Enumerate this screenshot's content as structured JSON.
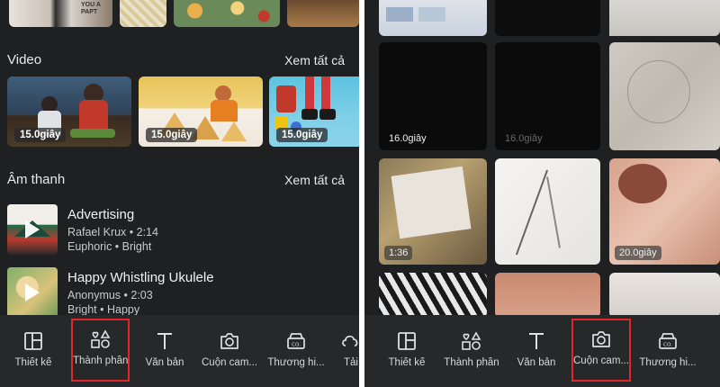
{
  "left": {
    "video_section": {
      "title": "Video",
      "see_all": "Xem tất cả"
    },
    "videos": [
      {
        "duration": "15.0giây"
      },
      {
        "duration": "15.0giây"
      },
      {
        "duration": "15.0giây"
      }
    ],
    "top_thumb_text": "YOU A PAPT",
    "audio_section": {
      "title": "Âm thanh",
      "see_all": "Xem tất cả"
    },
    "tracks": [
      {
        "title": "Advertising",
        "artist_duration": "Rafael Krux • 2:14",
        "tags": "Euphoric • Bright"
      },
      {
        "title": "Happy Whistling Ukulele",
        "artist_duration": "Anonymus • 2:03",
        "tags": "Bright • Happy"
      }
    ],
    "nav": [
      {
        "label": "Thiết kế",
        "icon": "layout-icon"
      },
      {
        "label": "Thành phần",
        "icon": "elements-icon",
        "selected": true
      },
      {
        "label": "Văn bản",
        "icon": "text-icon"
      },
      {
        "label": "Cuộn cam...",
        "icon": "camera-icon"
      },
      {
        "label": "Thương hi...",
        "icon": "brand-icon"
      },
      {
        "label": "Tải",
        "icon": "upload-icon"
      }
    ]
  },
  "right": {
    "grid_badges": {
      "video1": "16.0giây",
      "video2": "16.0giây",
      "video3": "1:36",
      "video4": "20.0giây"
    },
    "nav": [
      {
        "label": "Thiết kế",
        "icon": "layout-icon"
      },
      {
        "label": "Thành phần",
        "icon": "elements-icon"
      },
      {
        "label": "Văn bản",
        "icon": "text-icon"
      },
      {
        "label": "Cuộn cam...",
        "icon": "camera-icon",
        "selected": true
      },
      {
        "label": "Thương hi...",
        "icon": "brand-icon"
      }
    ]
  },
  "colors": {
    "background": "#1f2022",
    "nav_bg": "#27282a",
    "highlight": "#e3262a"
  }
}
